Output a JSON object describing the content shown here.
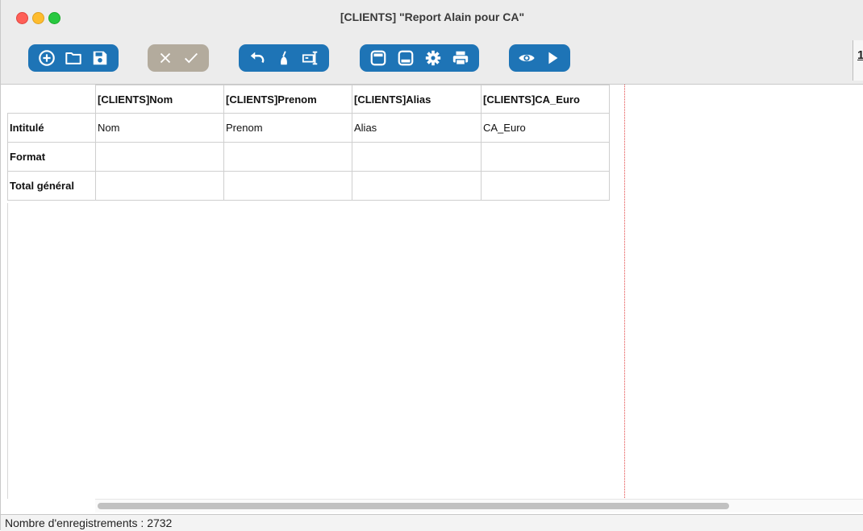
{
  "window": {
    "title": "[CLIENTS] \"Report Alain pour CA\""
  },
  "toolbar": {
    "groups": [
      {
        "name": "file",
        "buttons": [
          "add-circle-icon",
          "folder-icon",
          "save-icon"
        ]
      },
      {
        "name": "validate",
        "disabled": true,
        "buttons": [
          "cancel-icon",
          "check-icon"
        ]
      },
      {
        "name": "edit",
        "buttons": [
          "undo-icon",
          "clear-icon",
          "field-icon"
        ]
      },
      {
        "name": "layout",
        "buttons": [
          "header-panel-icon",
          "footer-panel-icon",
          "gear-icon",
          "print-icon"
        ]
      },
      {
        "name": "preview",
        "buttons": [
          "eye-icon",
          "play-icon"
        ]
      }
    ],
    "right_fragment": "1"
  },
  "grid": {
    "columns": [
      "[CLIENTS]Nom",
      "[CLIENTS]Prenom",
      "[CLIENTS]Alias",
      "[CLIENTS]CA_Euro"
    ],
    "rows": [
      {
        "label": "Intitulé",
        "cells": [
          "Nom",
          "Prenom",
          "Alias",
          "CA_Euro"
        ]
      },
      {
        "label": "Format",
        "cells": [
          "",
          "",
          "",
          ""
        ]
      },
      {
        "label": "Total général",
        "cells": [
          "",
          "",
          "",
          ""
        ]
      }
    ]
  },
  "status": {
    "text": "Nombre d'enregistrements : 2732"
  },
  "colors": {
    "toolbar_accent": "#1e74b6",
    "toolbar_disabled": "#b3ab9d",
    "margin_line": "#e34b4b"
  }
}
